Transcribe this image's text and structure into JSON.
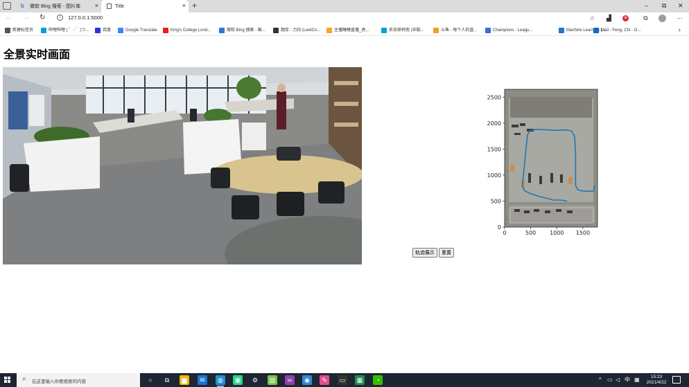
{
  "browser": {
    "tabs": [
      {
        "title": "微软 Bing 搜索 - 图片库",
        "icon": "bing-icon",
        "active": false
      },
      {
        "title": "Title",
        "icon": "page-icon",
        "active": true
      }
    ],
    "new_tab_symbol": "+",
    "close_symbol": "×",
    "window_controls": {
      "minimize": "–",
      "restore": "⧉",
      "close": "✕"
    },
    "address": "127.0.0.1:5000",
    "bookmarks": [
      {
        "label": "新建标签页",
        "icon": "page-icon",
        "color": "#555555"
      },
      {
        "label": "哔哩哔哩 ( ゜- ゜)つ...",
        "icon": "bilibili-icon",
        "color": "#00a1d6"
      },
      {
        "label": "百度",
        "icon": "baidu-icon",
        "color": "#2932e1"
      },
      {
        "label": "Google Translate",
        "icon": "translate-icon",
        "color": "#4285f4"
      },
      {
        "label": "King's College Lond...",
        "icon": "kcl-icon",
        "color": "#e2231a"
      },
      {
        "label": "微软 Bing 搜索 - 国...",
        "icon": "bing-icon",
        "color": "#2b7bd6"
      },
      {
        "label": "题库 - 力扣 (LeetCo...",
        "icon": "leetcode-icon",
        "color": "#333333"
      },
      {
        "label": "主播睡睡直播_虎...",
        "icon": "huya-icon",
        "color": "#f5a623"
      },
      {
        "label": "名侦探柯南 (中配...",
        "icon": "bilibili-icon",
        "color": "#00a1d6"
      },
      {
        "label": "斗鱼 - 每个人的直...",
        "icon": "douyu-icon",
        "color": "#f0a020"
      },
      {
        "label": "Champions - Leagu...",
        "icon": "lol-icon",
        "color": "#3b6fc8"
      },
      {
        "label": "Machine Learning |...",
        "icon": "coursera-icon",
        "color": "#2a73cc"
      },
      {
        "label": "Mail - Feng, Chi - O...",
        "icon": "outlook-icon",
        "color": "#0f6cbd"
      }
    ],
    "more_symbol": "›"
  },
  "page": {
    "title": "全景实时画面",
    "buttons": {
      "trajectory": "轨迹展示",
      "reset": "重置"
    }
  },
  "chart_data": {
    "type": "line",
    "title": "",
    "xlabel": "",
    "ylabel": "",
    "xlim": [
      0,
      1780
    ],
    "ylim": [
      0,
      2650
    ],
    "xticks": [
      0,
      500,
      1000,
      1500
    ],
    "yticks": [
      0,
      500,
      1000,
      1500,
      2000,
      2500
    ],
    "background": "floor-plan image",
    "series": [
      {
        "color": "#1f77b4",
        "x": [
          1720,
          1710,
          1690,
          1640,
          1560,
          1460,
          1400,
          1360,
          1360,
          1360,
          1340,
          1280,
          1180,
          1020,
          820,
          620,
          500,
          440,
          420,
          400,
          380,
          360,
          340,
          380,
          480,
          620,
          780,
          940,
          1080,
          1200
        ],
        "y": [
          800,
          700,
          690,
          690,
          690,
          700,
          720,
          800,
          1000,
          1400,
          1750,
          1850,
          1870,
          1860,
          1870,
          1880,
          1860,
          1780,
          1600,
          1400,
          1200,
          1000,
          800,
          700,
          650,
          600,
          560,
          520,
          520,
          500
        ]
      }
    ]
  },
  "taskbar": {
    "search_placeholder": "在这里输入你要搜索的内容",
    "apps": [
      {
        "name": "cortana",
        "symbol": "○",
        "color": "transparent"
      },
      {
        "name": "task-view",
        "symbol": "⧉",
        "color": "transparent"
      },
      {
        "name": "file-explorer",
        "symbol": "▆",
        "color": "#f2b600"
      },
      {
        "name": "mail",
        "symbol": "✉",
        "color": "#1976d2"
      },
      {
        "name": "edge",
        "symbol": "◍",
        "color": "#1f8fd6"
      },
      {
        "name": "pycharm",
        "symbol": "▣",
        "color": "#21d789"
      },
      {
        "name": "settings",
        "symbol": "⚙",
        "color": "transparent"
      },
      {
        "name": "notepad",
        "symbol": "▤",
        "color": "#7cc34a"
      },
      {
        "name": "visual-studio",
        "symbol": "∞",
        "color": "#8e44ad"
      },
      {
        "name": "photos",
        "symbol": "◉",
        "color": "#2e8bd6"
      },
      {
        "name": "paint",
        "symbol": "✎",
        "color": "#e04f8a"
      },
      {
        "name": "terminal",
        "symbol": "▭",
        "color": "#333333"
      },
      {
        "name": "excel",
        "symbol": "▦",
        "color": "#1d8f4f"
      },
      {
        "name": "wechat",
        "symbol": "◔",
        "color": "#2dc100"
      }
    ],
    "tray": {
      "chevron": "^",
      "ime": "中",
      "time": "15:23",
      "date": "2021/4/22"
    }
  }
}
